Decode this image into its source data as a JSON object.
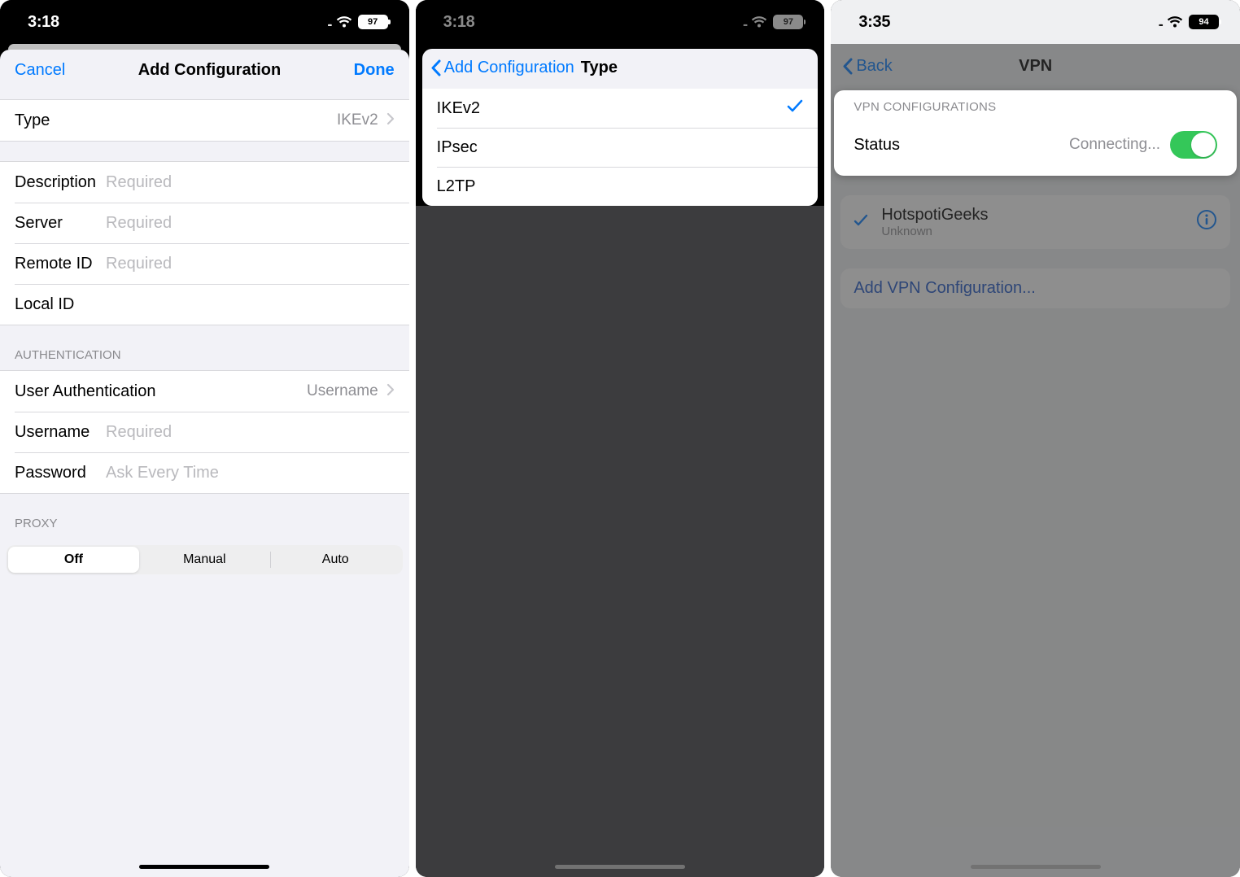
{
  "screen1": {
    "status": {
      "time": "3:18",
      "battery": "97"
    },
    "nav": {
      "cancel": "Cancel",
      "title": "Add Configuration",
      "done": "Done"
    },
    "type_row": {
      "label": "Type",
      "value": "IKEv2"
    },
    "fields": {
      "description": {
        "label": "Description",
        "placeholder": "Required"
      },
      "server": {
        "label": "Server",
        "placeholder": "Required"
      },
      "remote_id": {
        "label": "Remote ID",
        "placeholder": "Required"
      },
      "local_id": {
        "label": "Local ID",
        "placeholder": ""
      }
    },
    "auth_header": "AUTHENTICATION",
    "auth": {
      "user_auth": {
        "label": "User Authentication",
        "value": "Username"
      },
      "username": {
        "label": "Username",
        "placeholder": "Required"
      },
      "password": {
        "label": "Password",
        "placeholder": "Ask Every Time"
      }
    },
    "proxy_header": "PROXY",
    "proxy": {
      "off": "Off",
      "manual": "Manual",
      "auto": "Auto"
    }
  },
  "screen2": {
    "status": {
      "time": "3:18",
      "battery": "97"
    },
    "nav": {
      "back": "Add Configuration",
      "title": "Type"
    },
    "options": [
      {
        "label": "IKEv2",
        "selected": true
      },
      {
        "label": "IPsec",
        "selected": false
      },
      {
        "label": "L2TP",
        "selected": false
      }
    ]
  },
  "screen3": {
    "status": {
      "time": "3:35",
      "battery": "94"
    },
    "nav": {
      "back": "Back",
      "title": "VPN"
    },
    "section_header": "VPN CONFIGURATIONS",
    "status_row": {
      "label": "Status",
      "value": "Connecting..."
    },
    "config": {
      "name": "HotspotiGeeks",
      "sub": "Unknown"
    },
    "add": "Add VPN Configuration..."
  }
}
